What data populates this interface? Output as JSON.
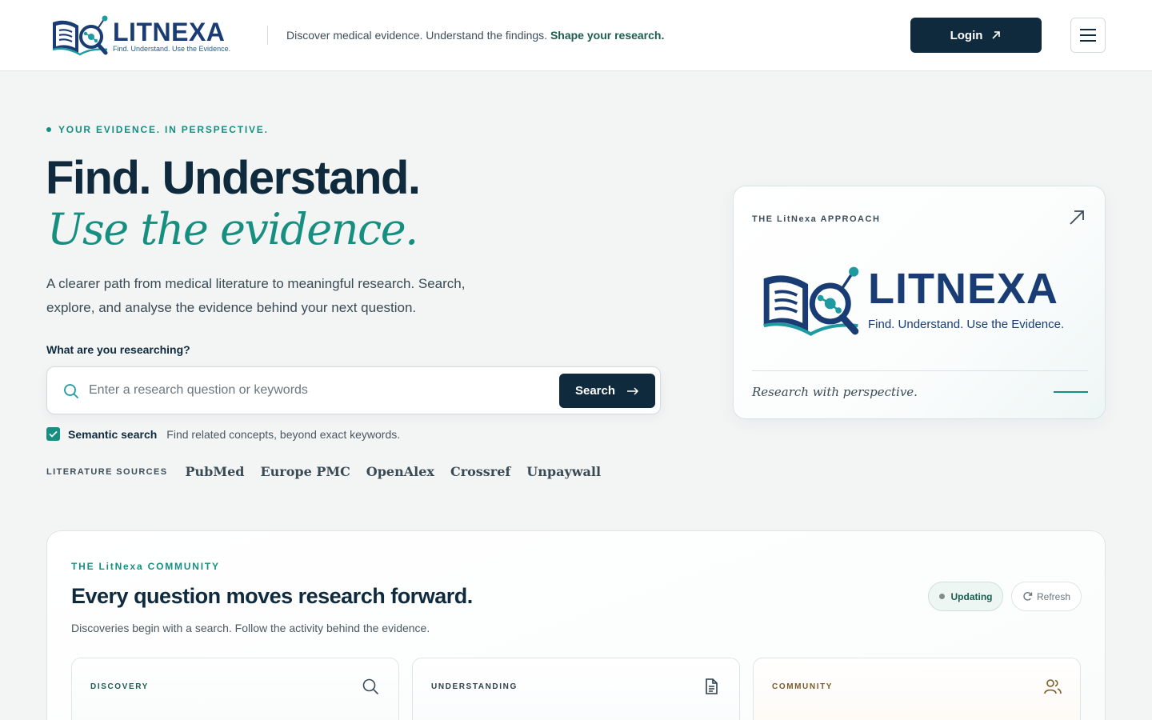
{
  "brand": {
    "name": "LITNEXA",
    "tagline": "Find. Understand. Use the Evidence.",
    "colors": {
      "navy": "#0f2a3d",
      "teal": "#168f80",
      "logo_blue": "#183c73"
    }
  },
  "header": {
    "tagline_plain": "Discover medical evidence. Understand the findings.",
    "tagline_strong": "Shape your research.",
    "login_label": "Login",
    "login_icon": "arrow-up-right-icon",
    "menu_icon": "hamburger-menu-icon"
  },
  "hero": {
    "eyebrow": "YOUR EVIDENCE. IN PERSPECTIVE.",
    "title": "Find. Understand.",
    "subtitle": "Use the evidence.",
    "description": "A clearer path from medical literature to meaningful research. Search, explore, and analyse the evidence behind your next question.",
    "search": {
      "label": "What are you researching?",
      "placeholder": "Enter a research question or keywords",
      "value": "",
      "button_label": "Search",
      "button_icon": "arrow-right-icon"
    },
    "semantic": {
      "checked": true,
      "label": "Semantic search",
      "hint": "Find related concepts, beyond exact keywords."
    },
    "sources": {
      "label": "LITERATURE SOURCES",
      "items": [
        "PubMed",
        "Europe PMC",
        "OpenAlex",
        "Crossref",
        "Unpaywall"
      ]
    }
  },
  "approach": {
    "title": "THE LitNexa APPROACH",
    "footer": "Research with perspective."
  },
  "community": {
    "eyebrow": "THE LitNexa COMMUNITY",
    "title": "Every question moves research forward.",
    "description": "Discoveries begin with a search. Follow the activity behind the evidence.",
    "status": "Updating",
    "refresh_label": "Refresh",
    "cards": [
      {
        "label": "DISCOVERY",
        "icon": "search-icon"
      },
      {
        "label": "UNDERSTANDING",
        "icon": "document-icon"
      },
      {
        "label": "COMMUNITY",
        "icon": "users-icon"
      }
    ]
  }
}
